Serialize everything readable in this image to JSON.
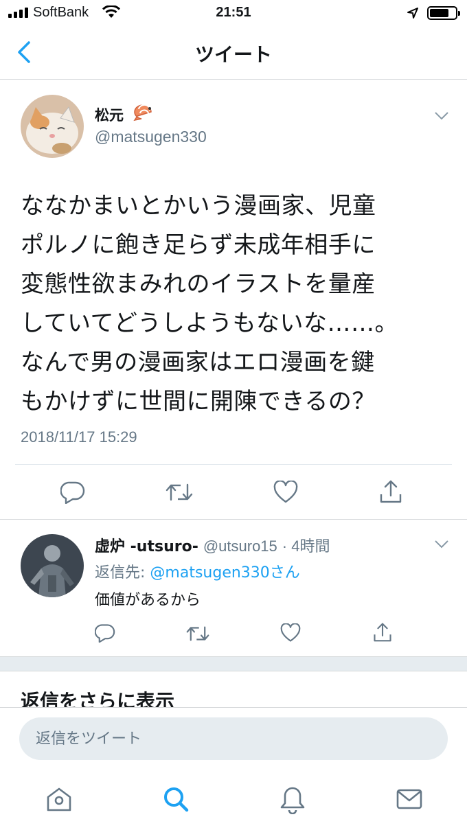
{
  "status_bar": {
    "carrier": "SoftBank",
    "time": "21:51",
    "battery_level": 0.75
  },
  "header": {
    "title": "ツイート"
  },
  "tweet": {
    "display_name": "松元",
    "handle": "@matsugen330",
    "lines": [
      "ななかまいとかいう漫画家、児童",
      "ポルノに飽き足らず未成年相手に",
      "変態性欲まみれのイラストを量産",
      "していてどうしようもないな……。",
      "なんで男の漫画家はエロ漫画を鍵",
      "もかけずに世間に開陳できるの？"
    ],
    "timestamp": "2018/11/17 15:29"
  },
  "reply": {
    "display_name": "虚炉 -utsuro-",
    "handle": "@utsuro15",
    "age": "· 4時間",
    "reply_to_prefix": "返信先: ",
    "reply_to_mention": "@matsugen330さん",
    "text": "価値があるから"
  },
  "more_replies": "返信をさらに表示",
  "composer": {
    "placeholder": "返信をツイート"
  },
  "colors": {
    "accent": "#1da1f2",
    "secondary_text": "#657786",
    "icon_gray": "#657786",
    "divider": "#e1e8ed"
  }
}
